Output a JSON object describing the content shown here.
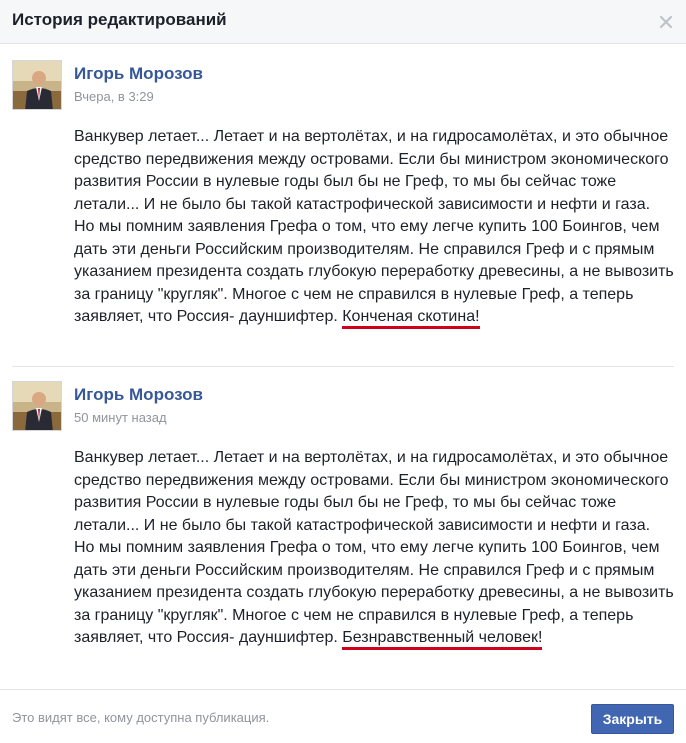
{
  "dialog": {
    "title": "История редактирований",
    "close_icon": "close-icon",
    "footer_note": "Это видят все, кому доступна публикация.",
    "close_label": "Закрыть",
    "accent_color": "#4267b2",
    "highlight_color": "#d0021b"
  },
  "entries": [
    {
      "author": "Игорь Морозов",
      "timestamp": "Вчера, в 3:29",
      "text_main": "Ванкувер летает... Летает и на вертолётах, и на гидросамолётах, и это обычное средство передвижения между островами. Если бы министром экономического развития России в нулевые годы был бы не Греф, то мы бы сейчас тоже летали... И не было бы такой катастрофической зависимости и нефти и газа. Но мы помним заявления Грефа о том, что ему легче купить 100 Боингов, чем дать эти деньги Российским производителям. Не справился Греф и с прямым указанием президента создать глубокую переработку древесины, а не вывозить за границу \"кругляк\". Многое с чем не справился в нулевые Греф, а теперь заявляет, что Россия- дауншифтер. ",
      "text_highlight": "Конченая скотина!"
    },
    {
      "author": "Игорь Морозов",
      "timestamp": "50 минут назад",
      "text_main": "Ванкувер летает... Летает и на вертолётах, и на гидросамолётах, и это обычное средство передвижения между островами. Если бы министром экономического развития России в нулевые годы был бы не Греф, то мы бы сейчас тоже летали... И не было бы такой катастрофической зависимости и нефти и газа. Но мы помним заявления Грефа о том, что ему легче купить 100 Боингов, чем дать эти деньги Российским производителям. Не справился Греф и с прямым указанием президента создать глубокую переработку древесины, а не вывозить за границу \"кругляк\". Многое с чем не справился в нулевые Греф, а теперь заявляет, что Россия- дауншифтер. ",
      "text_highlight": "Безнравственный человек!"
    }
  ]
}
